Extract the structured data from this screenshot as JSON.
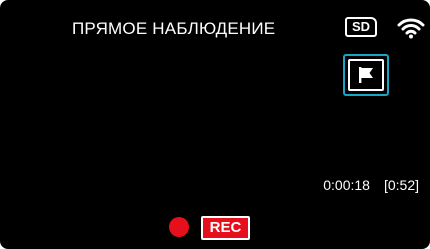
{
  "header": {
    "title": "ПРЯМОЕ НАБЛЮДЕНИЕ",
    "media_badge": "SD",
    "wifi_icon": "wifi-icon"
  },
  "marker_button": {
    "icon": "flag-icon"
  },
  "status": {
    "elapsed_time": "0:00:18",
    "remaining_time": "[0:52]"
  },
  "recording": {
    "indicator_icon": "record-dot-icon",
    "button_label": "REC"
  },
  "colors": {
    "background": "#000000",
    "text": "#ffffff",
    "highlight": "#19a6c6",
    "record": "#e5101c"
  }
}
